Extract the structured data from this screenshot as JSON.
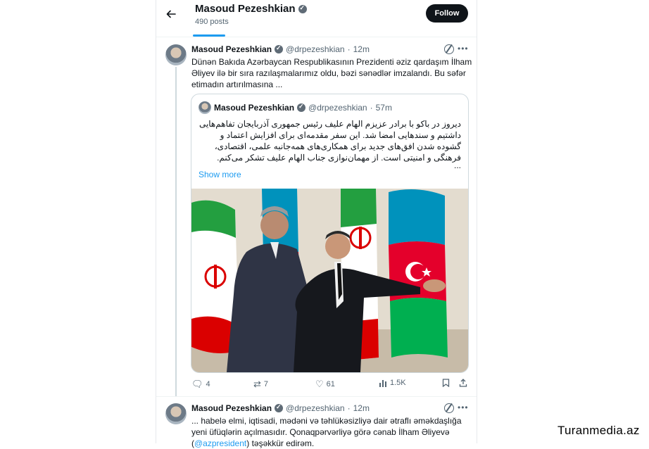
{
  "header": {
    "back_icon": "arrow-left-icon",
    "name": "Masoud Pezeshkian",
    "post_count": "490 posts",
    "follow_label": "Follow"
  },
  "tweet1": {
    "name": "Masoud Pezeshkian",
    "handle": "@drpezeshkian",
    "dot": "·",
    "time": "12m",
    "text": "Dünən Bakıda Azərbaycan Respublikasının Prezidenti əziz qardaşım İlham Əliyev ilə bir sıra razılaşmalarımız oldu, bəzi sənədlər imzalandı. Bu səfər etimadın artırılmasına ..."
  },
  "quote": {
    "name": "Masoud Pezeshkian",
    "handle": "@drpezeshkian",
    "dot": "·",
    "time": "57m",
    "text": "دیروز در باکو با برادر عزیزم الهام علیف رئیس جمهوری آذربایجان تفاهم‌هایی داشتیم و سندهایی امضا شد. این سفر مقدمه‌ای برای افزایش اعتماد و گشوده شدن افق‌های جدید برای همکاری‌های همه‌جانبه علمی، اقتصادی، فرهنگی و امنیتی است. از مهمان‌نوازی جناب الهام علیف تشکر می‌کنم.",
    "ellipsis": "...",
    "show_more": "Show more"
  },
  "actions": {
    "replies": "4",
    "reposts": "7",
    "likes": "61",
    "views": "1.5K"
  },
  "tweet2": {
    "name": "Masoud Pezeshkian",
    "handle": "@drpezeshkian",
    "dot": "·",
    "time": "12m",
    "text_before": "... habelə elmi, iqtisadi, mədəni və təhlükəsizliyə dair ətraflı əməkdaşlığa yeni üfüqlərin açılmasıdır. Qonaqpərvərliyə görə cənab İlham Əliyevə (",
    "mention": "@azpresident",
    "text_after": ") təşəkkür edirəm."
  },
  "watermark": "Turanmedia.az",
  "colors": {
    "accent": "#1d9bf0",
    "text": "#0f1419",
    "muted": "#536471",
    "iran_green": "#239f40",
    "iran_red": "#da0000",
    "az_blue": "#0092bc",
    "az_red": "#e4002b",
    "az_green": "#00af50"
  }
}
